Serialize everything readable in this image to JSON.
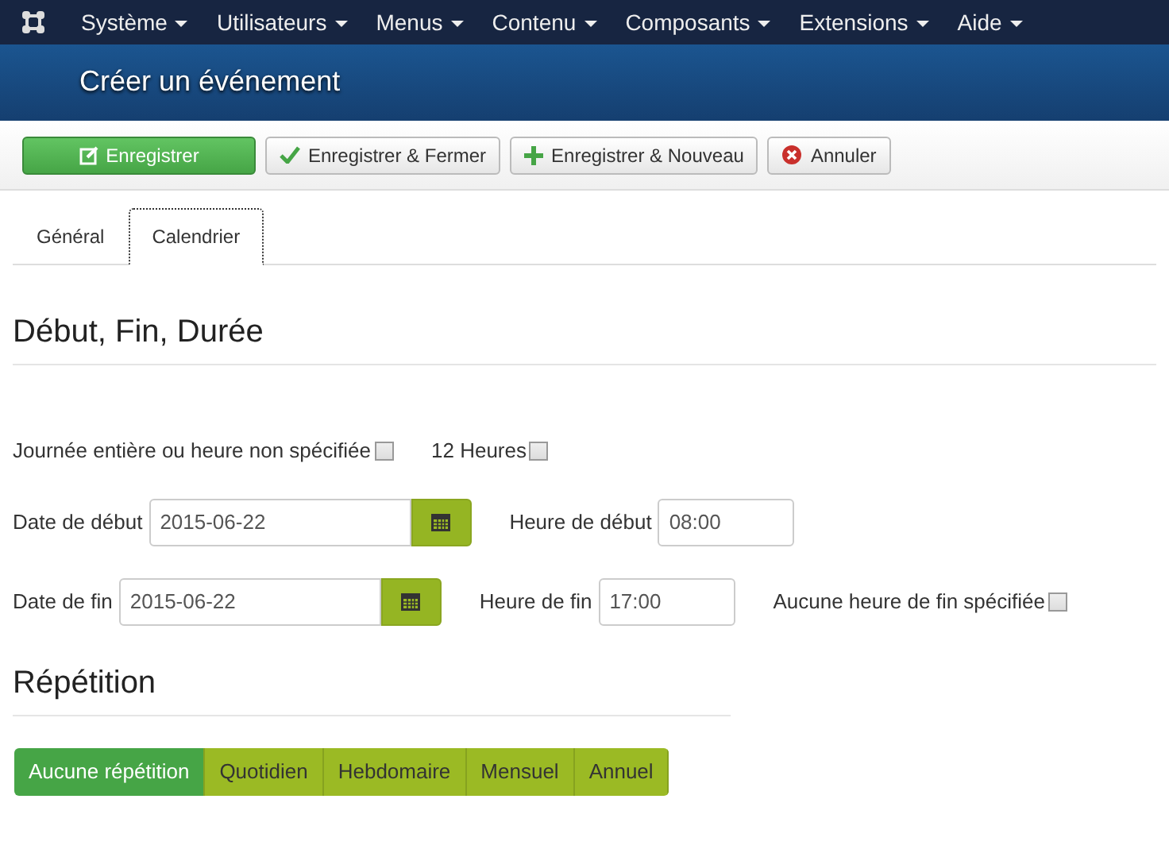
{
  "menu": [
    {
      "label": "Système"
    },
    {
      "label": "Utilisateurs"
    },
    {
      "label": "Menus"
    },
    {
      "label": "Contenu"
    },
    {
      "label": "Composants"
    },
    {
      "label": "Extensions"
    },
    {
      "label": "Aide"
    }
  ],
  "page_title": "Créer un événement",
  "toolbar": [
    {
      "label": "Enregistrer",
      "kind": "edit",
      "primary": true
    },
    {
      "label": "Enregistrer & Fermer",
      "kind": "check",
      "primary": false
    },
    {
      "label": "Enregistrer & Nouveau",
      "kind": "plus",
      "primary": false
    },
    {
      "label": "Annuler",
      "kind": "cancel",
      "primary": false
    }
  ],
  "tabs": [
    {
      "label": "Général",
      "selected": false
    },
    {
      "label": "Calendrier",
      "selected": true
    }
  ],
  "section_heading": "Début, Fin, Durée",
  "options": [
    {
      "label": "Journée entière ou heure non spécifiée",
      "checked": false
    },
    {
      "label": "12 Heures",
      "checked": false
    }
  ],
  "start": {
    "date_label": "Date de début",
    "date": "2015-06-22",
    "time_label": "Heure de début",
    "time": "08:00"
  },
  "end": {
    "date_label": "Date de fin",
    "date": "2015-06-22",
    "time_label": "Heure de fin",
    "time": "17:00",
    "no_end_label": "Aucune heure de fin spécifiée",
    "no_end_checked": false
  },
  "repeat_heading": "Répétition",
  "repeat_options": [
    {
      "label": "Aucune répétition",
      "selected": true
    },
    {
      "label": "Quotidien",
      "selected": false
    },
    {
      "label": "Hebdomaire",
      "selected": false
    },
    {
      "label": "Mensuel",
      "selected": false
    },
    {
      "label": "Annuel",
      "selected": false
    }
  ]
}
